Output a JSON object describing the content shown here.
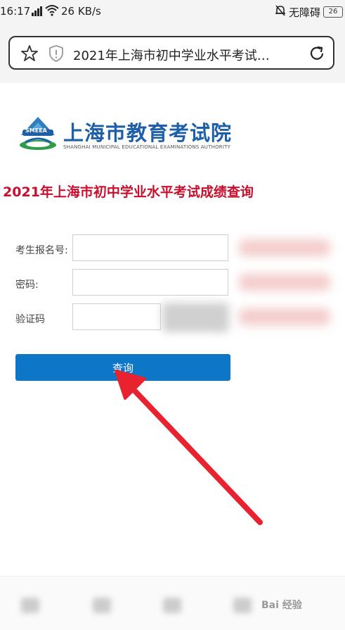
{
  "status_bar": {
    "time": "16:17",
    "network": "4G",
    "speed": "26 KB/s",
    "mute_label": "无障碍",
    "battery": "26"
  },
  "browser": {
    "url_title": "2021年上海市初中学业水平考试…"
  },
  "logo": {
    "title": "上海市教育考试院",
    "subtitle": "SHANGHAI MUNICIPAL EDUCATIONAL EXAMINATIONS AUTHORITY",
    "badge": "SMEEA"
  },
  "page": {
    "title": "2021年上海市初中学业水平考试成绩查询"
  },
  "form": {
    "reg_label": "考生报名号:",
    "password_label": "密码:",
    "captcha_label": "验证码",
    "reg_value": "",
    "password_value": "",
    "captcha_value": "",
    "submit_label": "查询"
  },
  "watermark": {
    "text": "Bai 经验"
  },
  "colors": {
    "accent": "#0e76c7",
    "title_red": "#c8102e",
    "arrow_red": "#e8232f",
    "logo_blue": "#1d5fa8"
  }
}
